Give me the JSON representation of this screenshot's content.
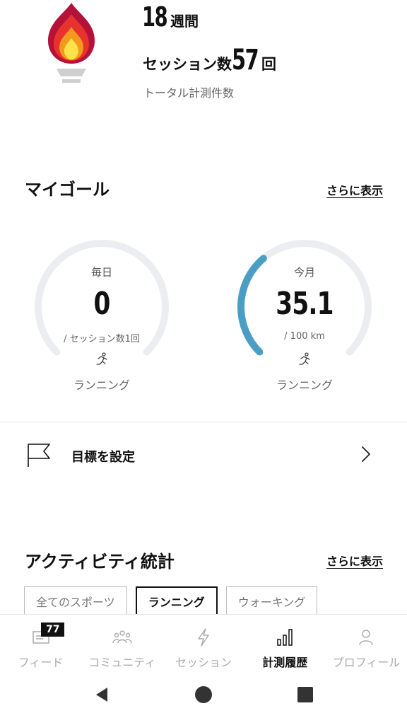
{
  "streak": {
    "weeks_value": "18",
    "weeks_unit": "週間",
    "sessions_label": "セッション数",
    "sessions_value": "57",
    "sessions_unit": "回",
    "subtitle": "トータル計測件数",
    "flame_colors": [
      "#b5123a",
      "#e8322e",
      "#f39a1e",
      "#ffe14a"
    ]
  },
  "my_goal": {
    "title": "マイゴール",
    "more_label": "さらに表示",
    "goals": [
      {
        "period": "毎日",
        "value": "0",
        "target": "/ セッション数1回",
        "sport": "ランニング",
        "progress": 0
      },
      {
        "period": "今月",
        "value": "35.1",
        "target": "/ 100 km",
        "sport": "ランニング",
        "progress": 0.351
      }
    ],
    "ring_track_color": "#ebedf0",
    "ring_progress_color": "#4a9ec4"
  },
  "set_goal": {
    "label": "目標を設定"
  },
  "activity_stats": {
    "title": "アクティビティ統計",
    "more_label": "さらに表示",
    "filters": [
      "全てのスポーツ",
      "ランニング",
      "ウォーキング"
    ],
    "selected_filter": "ランニング"
  },
  "bottom_nav": {
    "items": [
      {
        "label": "フィード",
        "icon": "feed-icon",
        "badge": "77"
      },
      {
        "label": "コミュニティ",
        "icon": "community-icon"
      },
      {
        "label": "セッション",
        "icon": "lightning-icon"
      },
      {
        "label": "計測履歴",
        "icon": "bar-chart-icon",
        "active": true
      },
      {
        "label": "プロフィール",
        "icon": "profile-icon"
      }
    ]
  }
}
